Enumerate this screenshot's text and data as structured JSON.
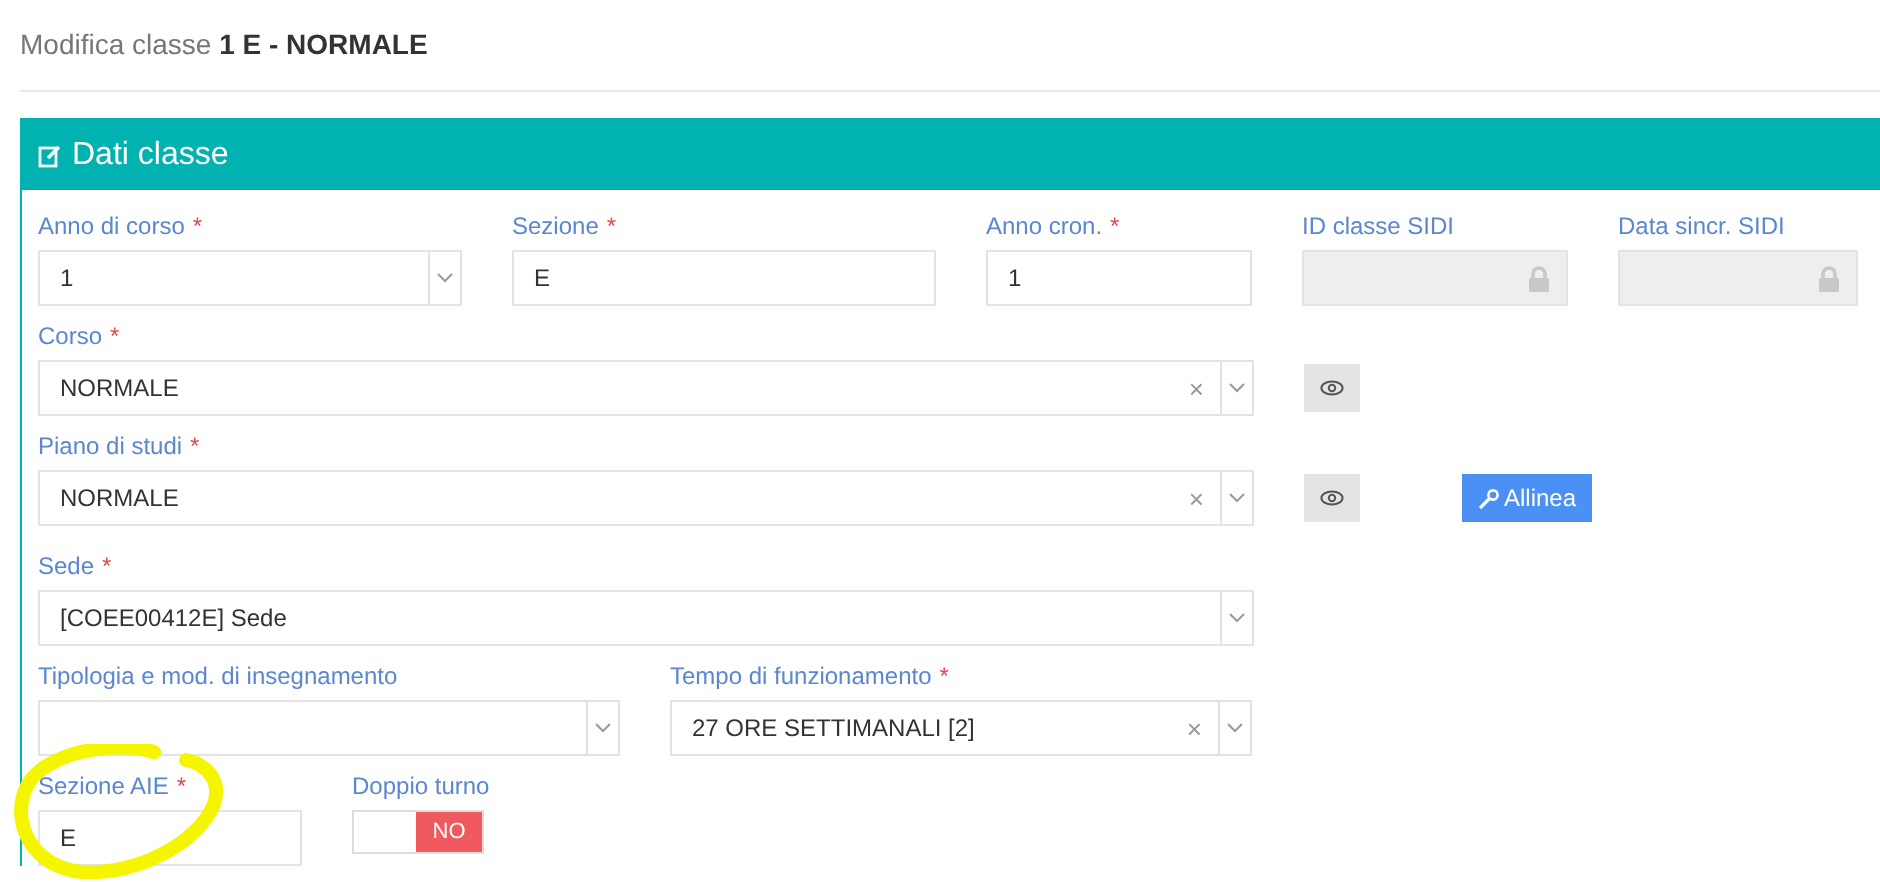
{
  "page_title": "Modifica classe **1 E - NORMALE**",
  "panel": {
    "title": "Dati classe",
    "form_lines": [
      {
        "fields": [
          {
            "kind": "select",
            "label": "Anno di corso",
            "required_mark": "*",
            "value": "1"
          },
          {
            "kind": "text",
            "label": "Sezione",
            "required_mark": "*",
            "value": "E"
          },
          {
            "kind": "text",
            "label": "Anno cron.",
            "required_mark": "*",
            "value": "1"
          },
          {
            "kind": "locked",
            "label": "ID classe SIDI"
          },
          {
            "kind": "locked",
            "label": "Data sincr. SIDI"
          }
        ]
      },
      {
        "fields": [
          {
            "kind": "select",
            "label": "Corso",
            "required_mark": "*",
            "value": "NORMALE",
            "clear_mark": "×",
            "actions": [
              {
                "kind": "view"
              }
            ]
          }
        ]
      },
      {
        "fields": [
          {
            "kind": "select",
            "label": "Piano di studi",
            "required_mark": "*",
            "value": "NORMALE",
            "clear_mark": "×",
            "actions": [
              {
                "kind": "view"
              },
              {
                "kind": "button",
                "label": "Allinea"
              }
            ]
          }
        ]
      },
      {
        "fields": [
          {
            "kind": "select",
            "label": "Sede",
            "required_mark": "*",
            "value": "[COEE00412E] Sede"
          }
        ]
      },
      {
        "fields": [
          {
            "kind": "select",
            "label": "Tipologia e mod. di insegnamento"
          },
          {
            "kind": "select",
            "label": "Tempo di funzionamento",
            "required_mark": "*",
            "value": "27 ORE SETTIMANALI [2]",
            "clear_mark": "×"
          }
        ]
      },
      {
        "fields": [
          {
            "kind": "text",
            "label": "Sezione AIE",
            "required_mark": "*",
            "value": "E",
            "highlighted": true
          },
          {
            "kind": "switch",
            "label": "Doppio turno",
            "on": false,
            "state_text": "NO"
          }
        ]
      }
    ]
  }
}
